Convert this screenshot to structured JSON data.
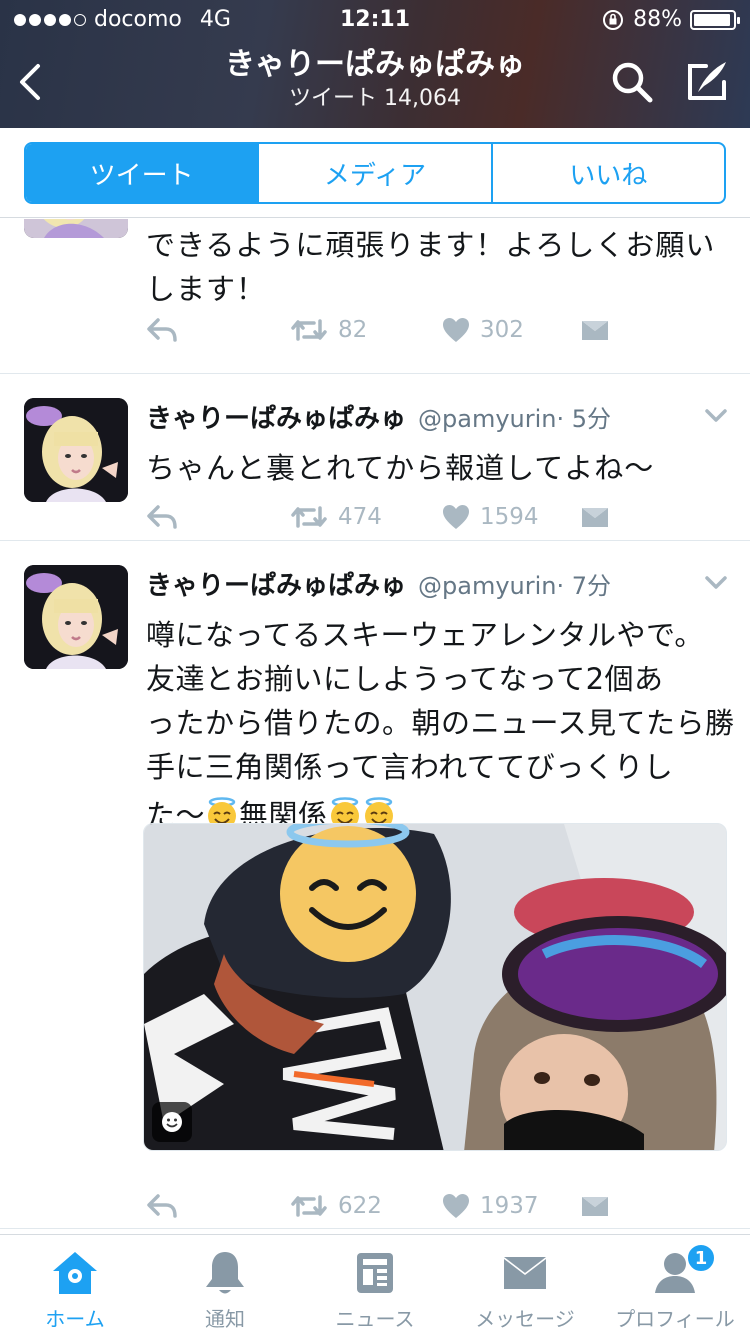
{
  "status_bar": {
    "carrier": "docomo",
    "network": "4G",
    "time": "12:11",
    "battery": "88%",
    "battery_level": 0.88
  },
  "header": {
    "title": "きゃりーぱみゅぱみゅ",
    "subtitle": "ツイート 14,064"
  },
  "segments": {
    "tweets": "ツイート",
    "media": "メディア",
    "likes": "いいね",
    "active": "tweets"
  },
  "tweets": [
    {
      "text": "できるように頑張ります！よろしくお願いします！",
      "retweets": "82",
      "likes": "302"
    },
    {
      "name": "きゃりーぱみゅぱみゅ",
      "handle": "@pamyurin",
      "time": "· 5分",
      "text": "ちゃんと裏とれてから報道してよね〜",
      "retweets": "474",
      "likes": "1594"
    },
    {
      "name": "きゃりーぱみゅぱみゅ",
      "handle": "@pamyurin",
      "time": "· 7分",
      "text_line1": "噂になってるスキーウェアレンタルやで。",
      "text_line2": "友達とお揃いにしようってなって2個あ",
      "text_line3": "ったから借りたの。朝のニュース見てたら勝",
      "text_line4": "手に三角関係って言われててびっくりし",
      "text_line5_a": "た〜",
      "text_line5_b": "無関係",
      "retweets": "622",
      "likes": "1937"
    }
  ],
  "tabbar": {
    "home": "ホーム",
    "notifications": "通知",
    "news": "ニュース",
    "messages": "メッセージ",
    "profile": "プロフィール",
    "profile_badge": "1",
    "active": "home"
  },
  "colors": {
    "accent": "#1da1f2",
    "action_gray": "#aab8c2",
    "text": "#14171a",
    "secondary": "#657786"
  }
}
